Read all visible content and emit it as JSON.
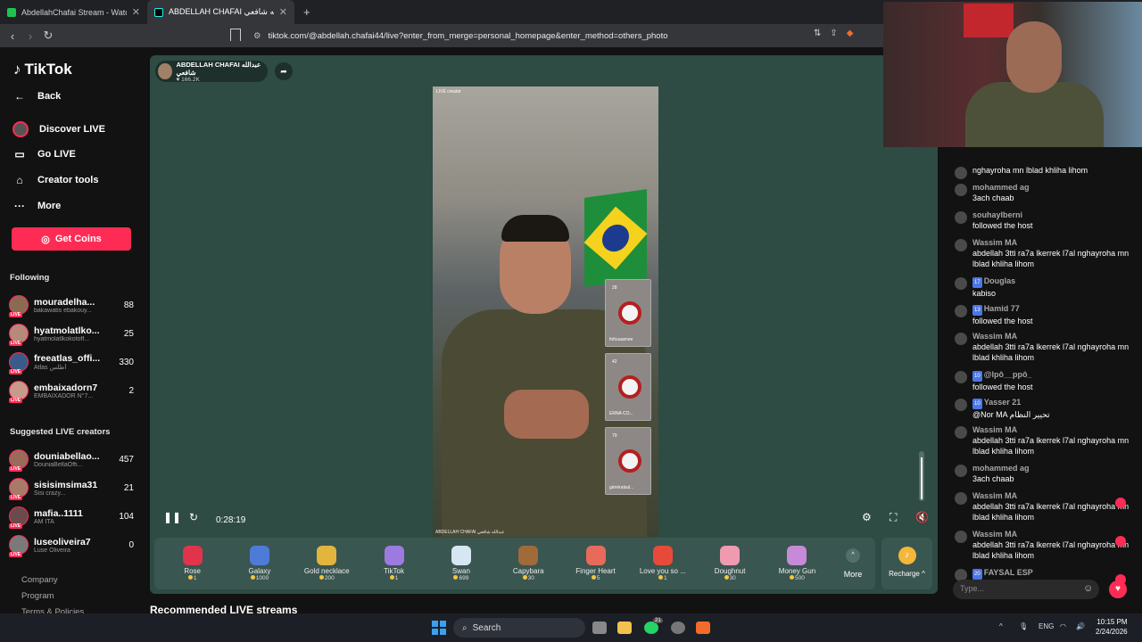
{
  "browser": {
    "tabs": [
      {
        "title": "AbdellahChafai Stream - Watch Live...",
        "active": false
      },
      {
        "title": "ABDELLAH CHAFAI عبدالله شافعي",
        "active": true
      }
    ],
    "new_tab": "+",
    "url": "tiktok.com/@abdellah.chafai44/live?enter_from_merge=personal_homepage&enter_method=others_photo",
    "nav_back": "‹",
    "nav_forward": "›",
    "nav_reload": "↻"
  },
  "sidebar": {
    "brand": "TikTok",
    "back": "Back",
    "menu": [
      "Discover LIVE",
      "Go LIVE",
      "Creator tools",
      "More"
    ],
    "get_coins": "Get Coins",
    "following_title": "Following",
    "following": [
      {
        "name": "mouradelha...",
        "sub": "bakawatis ebakouy...",
        "count": "88"
      },
      {
        "name": "hyatmolatlko...",
        "sub": "hyatmolatlkokotoff...",
        "count": "25"
      },
      {
        "name": "freeatlas_offi...",
        "sub": "Atlas أطلس",
        "count": "330"
      },
      {
        "name": "embaixadorn7",
        "sub": "EMBAIXADOR N°7...",
        "count": "2"
      }
    ],
    "suggested_title": "Suggested LIVE creators",
    "suggested": [
      {
        "name": "douniabellao...",
        "sub": "DouniaBellaOffi...",
        "count": "457"
      },
      {
        "name": "sisisimsima31",
        "sub": "Sisi crazy...",
        "count": "21"
      },
      {
        "name": "mafia..1111",
        "sub": "AM ITA",
        "count": "104"
      },
      {
        "name": "luseoliveira7",
        "sub": "Luse Oliveira",
        "count": "0"
      }
    ],
    "footer": [
      "Company",
      "Program",
      "Terms & Policies"
    ]
  },
  "player": {
    "host_name": "ABDELLAH CHAFAI عبدالله شافعي",
    "host_likes": "166.2K",
    "video_tag": "LIVE creator",
    "watermark": "ABDELLAH CHAFAI عبدالله شافعي",
    "guests": [
      {
        "count": "28",
        "name": "fofouaamee"
      },
      {
        "count": "42",
        "name": "ERNA CO..."
      },
      {
        "count": "79",
        "name": "généralsal..."
      }
    ],
    "time": "0:28:19",
    "volume_level": 0.9
  },
  "gifts": [
    {
      "name": "Rose",
      "price": "1",
      "color": "#e0344c"
    },
    {
      "name": "Galaxy",
      "price": "1000",
      "color": "#4f7bd8"
    },
    {
      "name": "Gold necklace",
      "price": "200",
      "color": "#e2b53c"
    },
    {
      "name": "TikTok",
      "price": "1",
      "color": "#9d7ae0"
    },
    {
      "name": "Swan",
      "price": "699",
      "color": "#d6e6f2"
    },
    {
      "name": "Capybara",
      "price": "30",
      "color": "#a06a3a"
    },
    {
      "name": "Finger Heart",
      "price": "5",
      "color": "#e86a5a"
    },
    {
      "name": "Love you so ...",
      "price": "1",
      "color": "#e84a3a"
    },
    {
      "name": "Doughnut",
      "price": "30",
      "color": "#f09ab0"
    },
    {
      "name": "Money Gun",
      "price": "500",
      "color": "#c68ad8"
    }
  ],
  "more_label": "More",
  "recharge_label": "Recharge",
  "recommended": "Recommended LIVE streams",
  "chat": [
    {
      "nick": "",
      "text": "nghayroha mn lblad khliha lihom",
      "badge": "",
      "heart": false
    },
    {
      "nick": "mohammed ag",
      "text": "3ach chaab",
      "badge": "",
      "heart": false
    },
    {
      "nick": "souhaylberni",
      "text": "followed the host",
      "badge": "",
      "heart": false
    },
    {
      "nick": "Wassim MA",
      "text": "abdellah 3tti ra7a lkerrek l7al nghayroha mn lblad khliha lihom",
      "badge": "",
      "heart": false
    },
    {
      "nick": "Douglas",
      "text": "kabiso",
      "badge": "17",
      "heart": false
    },
    {
      "nick": "Hamid 77",
      "text": "followed the host",
      "badge": "13",
      "heart": false
    },
    {
      "nick": "Wassim MA",
      "text": "abdellah 3tti ra7a lkerrek l7al nghayroha mn lblad khliha lihom",
      "badge": "",
      "heart": false
    },
    {
      "nick": "@lpô__ppô_",
      "text": "followed the host",
      "badge": "10",
      "heart": false
    },
    {
      "nick": "Yasser 21",
      "text": "@Nor MA تحيير النظام",
      "badge": "10",
      "heart": false
    },
    {
      "nick": "Wassim MA",
      "text": "abdellah 3tti ra7a lkerrek l7al nghayroha mn lblad khliha lihom",
      "badge": "",
      "heart": false
    },
    {
      "nick": "mohammed ag",
      "text": "3ach chaab",
      "badge": "",
      "heart": false
    },
    {
      "nick": "Wassim MA",
      "text": "abdellah 3tti ra7a lkerrek l7al nghayroha mn lblad khliha lihom",
      "badge": "",
      "heart": true
    },
    {
      "nick": "Wassim MA",
      "text": "abdellah 3tti ra7a lkerrek l7al nghayroha mn lblad khliha lihom",
      "badge": "",
      "heart": true
    },
    {
      "nick": "FAYSAL ESP",
      "text": "joined",
      "badge": "20",
      "heart": true
    }
  ],
  "chat_placeholder": "Type...",
  "taskbar": {
    "search": "Search",
    "lang": "ENG",
    "time": "10:15 PM",
    "date": "2/24/2026",
    "badge": "21"
  }
}
